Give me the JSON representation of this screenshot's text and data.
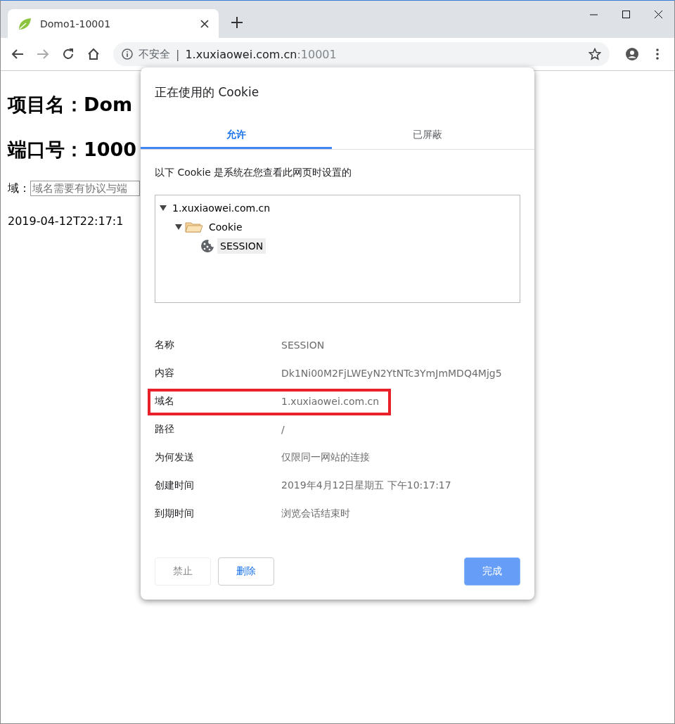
{
  "browser_tab": {
    "title": "Domo1-10001"
  },
  "address_bar": {
    "security": "不安全",
    "divider": "|",
    "host": "1.xuxiaowei.com.cn",
    "port": ":10001"
  },
  "page": {
    "heading_1": "项目名：Dom",
    "heading_2": "端口号：1000",
    "field_label": "域：",
    "field": {
      "placeholder": "域名需要有协议与端"
    },
    "timestamp": "2019-04-12T22:17:1"
  },
  "dialog": {
    "title": "正在使用的 Cookie",
    "tabs": [
      {
        "label": "允许",
        "selected": true
      },
      {
        "label": "已屏蔽",
        "selected": false
      }
    ],
    "description": "以下 Cookie 是系统在您查看此网页时设置的",
    "tree": [
      {
        "kind": "site",
        "label": "1.xuxiaowei.com.cn",
        "expanded": true,
        "selected": false,
        "children": [
          {
            "kind": "folder",
            "label": "Cookie",
            "expanded": true,
            "selected": false,
            "children": [
              {
                "kind": "cookie",
                "label": "SESSION",
                "selected": true
              }
            ]
          }
        ]
      }
    ],
    "details": [
      {
        "label": "名称",
        "value": "SESSION",
        "highlighted": false
      },
      {
        "label": "内容",
        "value": "Dk1Ni00M2FjLWEyN2YtNTc3YmJmMDQ4Mjg5",
        "highlighted": false
      },
      {
        "label": "域名",
        "value": "1.xuxiaowei.com.cn",
        "highlighted": true
      },
      {
        "label": "路径",
        "value": "/",
        "highlighted": false
      },
      {
        "label": "为何发送",
        "value": "仅限同一网站的连接",
        "highlighted": false
      },
      {
        "label": "创建时间",
        "value": "2019年4月12日星期五 下午10:17:17",
        "highlighted": false
      },
      {
        "label": "到期时间",
        "value": "浏览会话结束时",
        "highlighted": false
      }
    ],
    "buttons": [
      {
        "label": "禁止",
        "kind": "secondary",
        "disabled": true
      },
      {
        "label": "删除",
        "kind": "secondary",
        "disabled": false
      },
      {
        "label": "完成",
        "kind": "primary",
        "disabled": false
      }
    ]
  }
}
